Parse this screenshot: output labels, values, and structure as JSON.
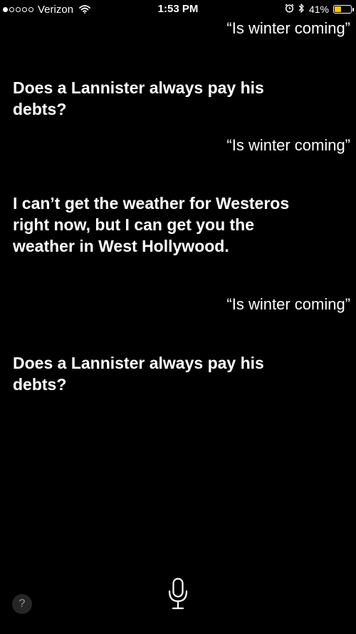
{
  "status_bar": {
    "carrier": "Verizon",
    "time": "1:53 PM",
    "battery_percent": "41%",
    "battery_level": 0.41,
    "signal_bars_filled": 1,
    "signal_bars_total": 5,
    "icons": [
      "wifi-icon",
      "alarm-icon",
      "bluetooth-icon",
      "battery-icon"
    ]
  },
  "conversation": [
    {
      "type": "query",
      "text": "“Is winter coming”"
    },
    {
      "type": "response",
      "text": "Does a Lannister always pay his debts?"
    },
    {
      "type": "query",
      "text": "“Is winter coming”"
    },
    {
      "type": "response",
      "text": "I can’t get the weather for Westeros right now, but I can get you the weather in West Hollywood."
    },
    {
      "type": "query",
      "text": "“Is winter coming”"
    },
    {
      "type": "response",
      "text": "Does a Lannister always pay his debts?"
    }
  ],
  "controls": {
    "help_label": "?",
    "icons": [
      "help-icon",
      "microphone-icon"
    ]
  },
  "colors": {
    "background": "#000000",
    "text": "#ffffff",
    "battery": "#f5c518"
  }
}
